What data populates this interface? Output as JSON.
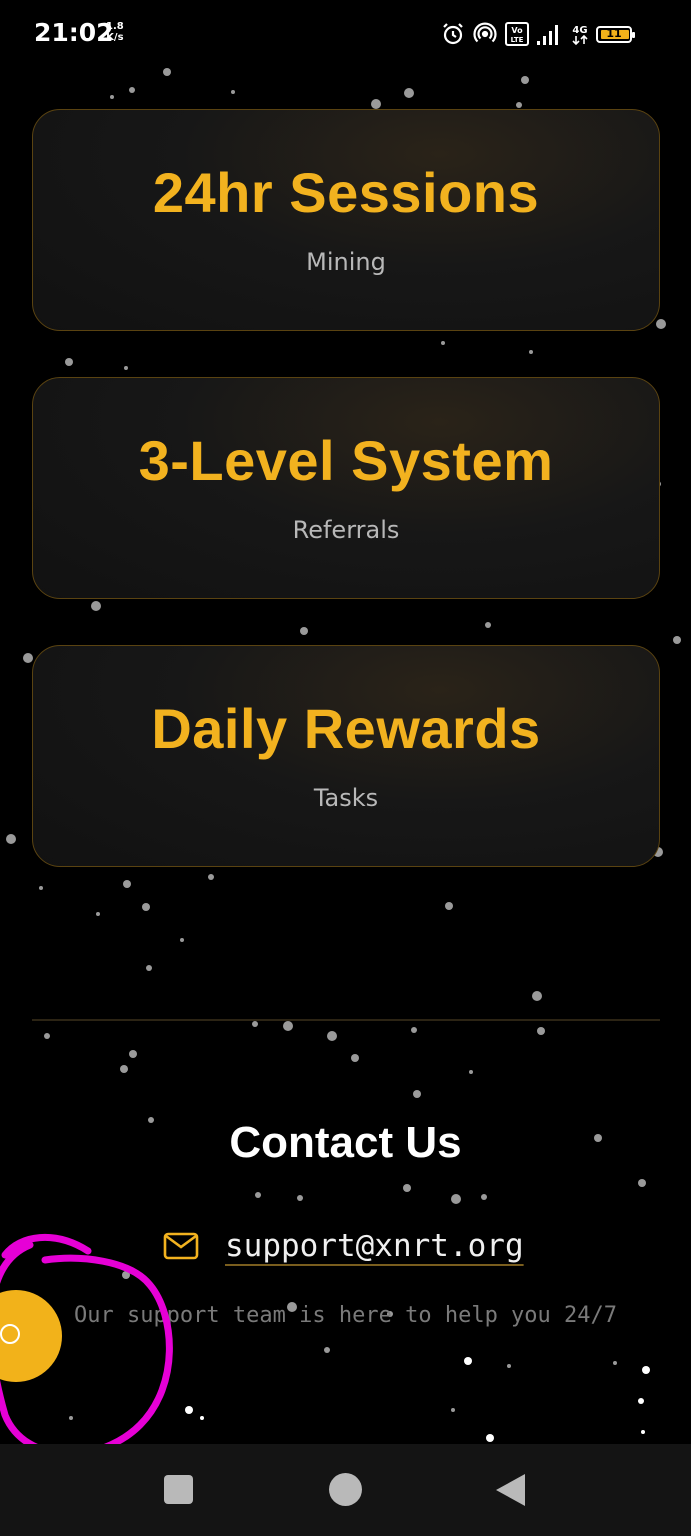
{
  "status_bar": {
    "time": "21:02",
    "net_speed_value": "1.8",
    "net_speed_unit": "K/s",
    "battery_level": "11",
    "icons": [
      "alarm-icon",
      "hotspot-icon",
      "volte-icon",
      "signal-icon",
      "4g-icon",
      "battery-icon"
    ]
  },
  "features": [
    {
      "title": "24hr Sessions",
      "subtitle": "Mining"
    },
    {
      "title": "3-Level System",
      "subtitle": "Referrals"
    },
    {
      "title": "Daily Rewards",
      "subtitle": "Tasks"
    }
  ],
  "contact": {
    "title": "Contact Us",
    "email": "support@xnrt.org",
    "note": "Our support team is here to help you 24/7"
  },
  "colors": {
    "accent": "#f2b21f",
    "background": "#000000",
    "card_border": "#5a4311",
    "annotation": "#e600d6"
  },
  "nav_bar": {
    "icons": [
      "recents-square-icon",
      "home-circle-icon",
      "back-triangle-icon"
    ]
  }
}
